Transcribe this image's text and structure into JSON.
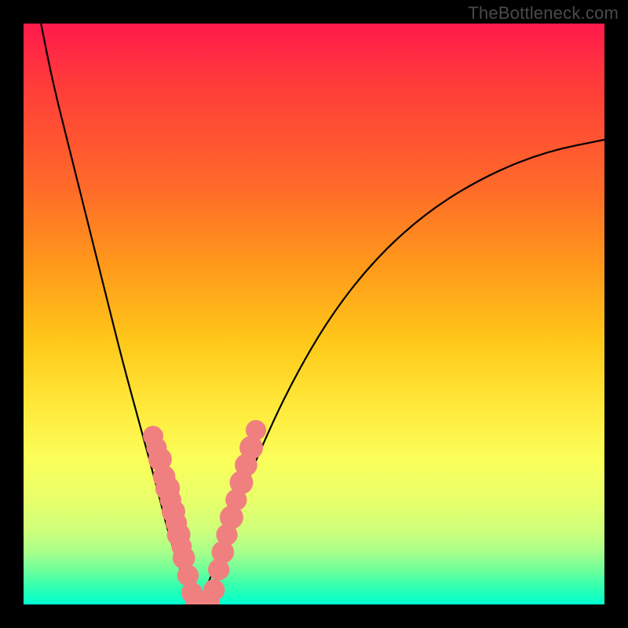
{
  "watermark": "TheBottleneck.com",
  "chart_data": {
    "type": "line",
    "title": "",
    "xlabel": "",
    "ylabel": "",
    "xlim": [
      0,
      100
    ],
    "ylim": [
      0,
      100
    ],
    "grid": false,
    "legend": false,
    "series": [
      {
        "name": "bottleneck-curve",
        "color": "#000000",
        "x": [
          3,
          5,
          8,
          11,
          14,
          17,
          20,
          23,
          25,
          27,
          28.5,
          30,
          32,
          35,
          40,
          46,
          53,
          61,
          70,
          80,
          90,
          100
        ],
        "y": [
          100,
          90,
          78,
          66,
          54,
          42,
          31,
          20,
          12,
          6,
          2,
          0,
          4,
          12,
          25,
          38,
          50,
          60,
          68,
          74,
          78,
          80
        ]
      },
      {
        "name": "dot-overlay",
        "color": "#f08080",
        "marker": "circle",
        "points": [
          {
            "x": 22.3,
            "y": 29,
            "r": 1.2
          },
          {
            "x": 22.9,
            "y": 27,
            "r": 1.2
          },
          {
            "x": 23.5,
            "y": 25,
            "r": 1.5
          },
          {
            "x": 24.2,
            "y": 22,
            "r": 1.4
          },
          {
            "x": 24.8,
            "y": 20,
            "r": 1.6
          },
          {
            "x": 25.3,
            "y": 18,
            "r": 1.3
          },
          {
            "x": 25.8,
            "y": 16,
            "r": 1.5
          },
          {
            "x": 26.3,
            "y": 14,
            "r": 1.3
          },
          {
            "x": 26.7,
            "y": 12,
            "r": 1.5
          },
          {
            "x": 27.2,
            "y": 10,
            "r": 1.2
          },
          {
            "x": 27.6,
            "y": 8,
            "r": 1.4
          },
          {
            "x": 28.3,
            "y": 5,
            "r": 1.3
          },
          {
            "x": 29.0,
            "y": 2,
            "r": 1.3
          },
          {
            "x": 29.8,
            "y": 0.6,
            "r": 1.4
          },
          {
            "x": 30.8,
            "y": 0.5,
            "r": 1.3
          },
          {
            "x": 31.8,
            "y": 0.6,
            "r": 1.4
          },
          {
            "x": 32.8,
            "y": 2.5,
            "r": 1.3
          },
          {
            "x": 33.6,
            "y": 6,
            "r": 1.3
          },
          {
            "x": 34.3,
            "y": 9,
            "r": 1.4
          },
          {
            "x": 35.0,
            "y": 12,
            "r": 1.3
          },
          {
            "x": 35.8,
            "y": 15,
            "r": 1.5
          },
          {
            "x": 36.6,
            "y": 18,
            "r": 1.3
          },
          {
            "x": 37.5,
            "y": 21,
            "r": 1.5
          },
          {
            "x": 38.3,
            "y": 24,
            "r": 1.4
          },
          {
            "x": 39.2,
            "y": 27,
            "r": 1.5
          },
          {
            "x": 40.0,
            "y": 30,
            "r": 1.2
          }
        ]
      }
    ],
    "annotations": [
      {
        "type": "connector",
        "shape": "rounded-bar",
        "color": "#f08080",
        "x0": 29.5,
        "x1": 32.0,
        "y": 0.4
      }
    ]
  }
}
